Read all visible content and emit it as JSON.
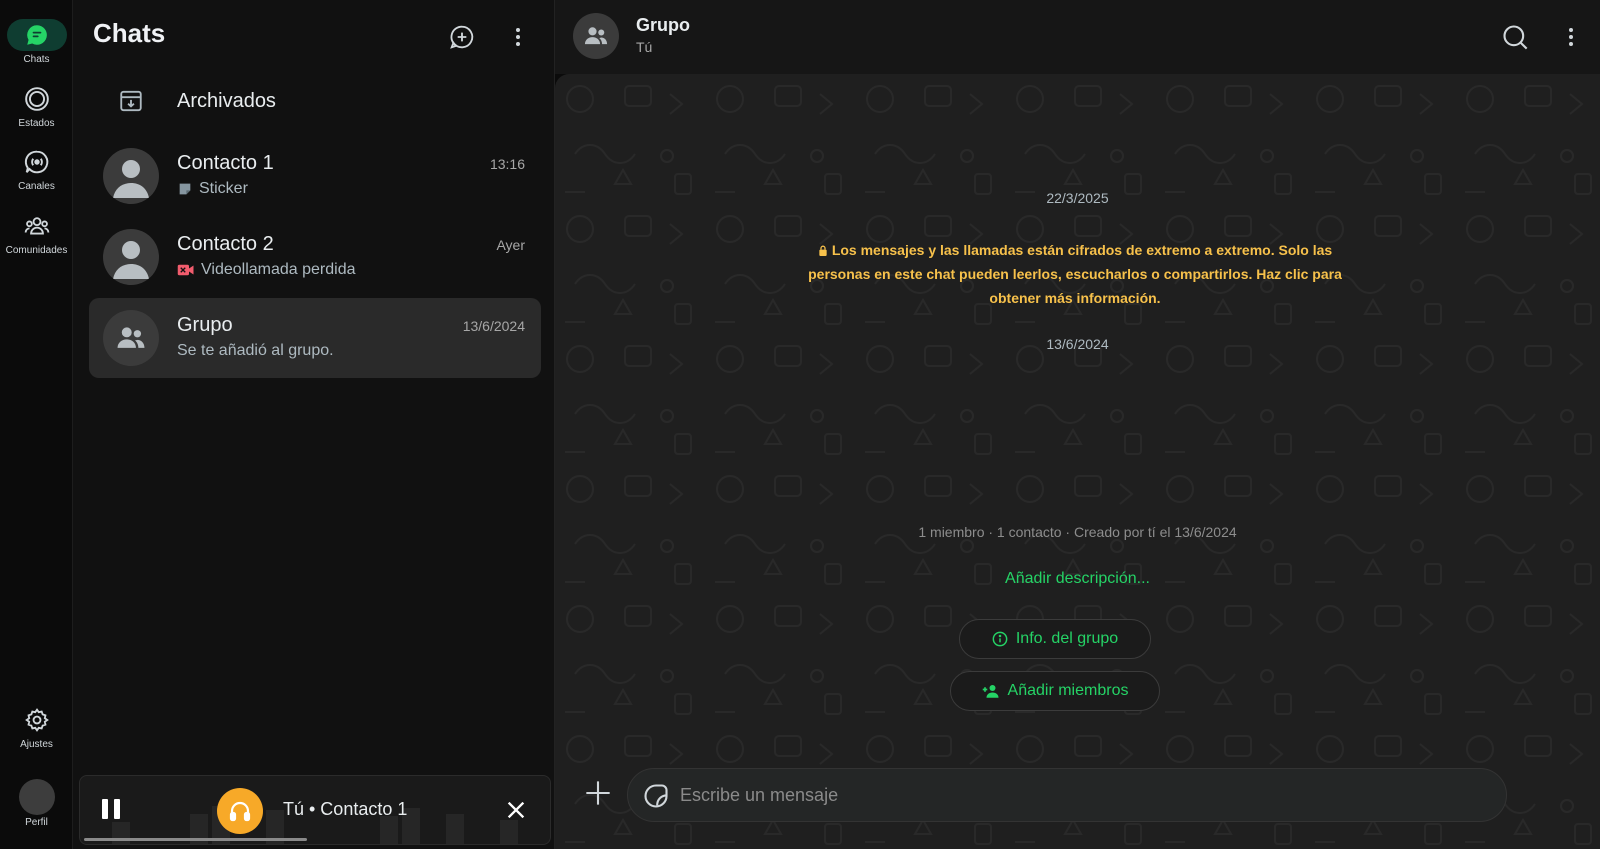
{
  "rail": {
    "items": [
      {
        "label": "Chats"
      },
      {
        "label": "Estados"
      },
      {
        "label": "Canales"
      },
      {
        "label": "Comunidades"
      }
    ],
    "settings_label": "Ajustes",
    "profile_label": "Perfil"
  },
  "list": {
    "title": "Chats",
    "archived_label": "Archivados",
    "chats": [
      {
        "name": "Contacto 1",
        "time": "13:16",
        "preview": "Sticker",
        "preview_icon": "sticker-icon"
      },
      {
        "name": "Contacto 2",
        "time": "Ayer",
        "preview": "Videollamada perdida",
        "preview_icon": "missed-video-call-icon"
      },
      {
        "name": "Grupo",
        "time": "13/6/2024",
        "preview": "Se te añadió al grupo.",
        "active": true
      }
    ]
  },
  "player": {
    "title": "Tú • Contacto 1",
    "progress": 0.48
  },
  "conversation": {
    "title": "Grupo",
    "subtitle": "Tú",
    "date1": "22/3/2025",
    "encryption_notice": "Los mensajes y las llamadas están cifrados de extremo a extremo. Solo las personas en este chat pueden leerlos, escucharlos o compartirlos. Haz clic para obtener más información.",
    "date2": "13/6/2024",
    "group_meta": "1 miembro · 1 contacto · Creado por tí el 13/6/2024",
    "add_description": "Añadir descripción...",
    "group_info_button": "Info. del grupo",
    "add_members_button": "Añadir miembros",
    "composer_placeholder": "Escribe un mensaje"
  },
  "colors": {
    "accent": "#25d366",
    "active_rail": "#0f3d31",
    "encryption_text": "#f7c14b",
    "player_badge": "#f7a928",
    "missed_call": "#f15c6d"
  }
}
